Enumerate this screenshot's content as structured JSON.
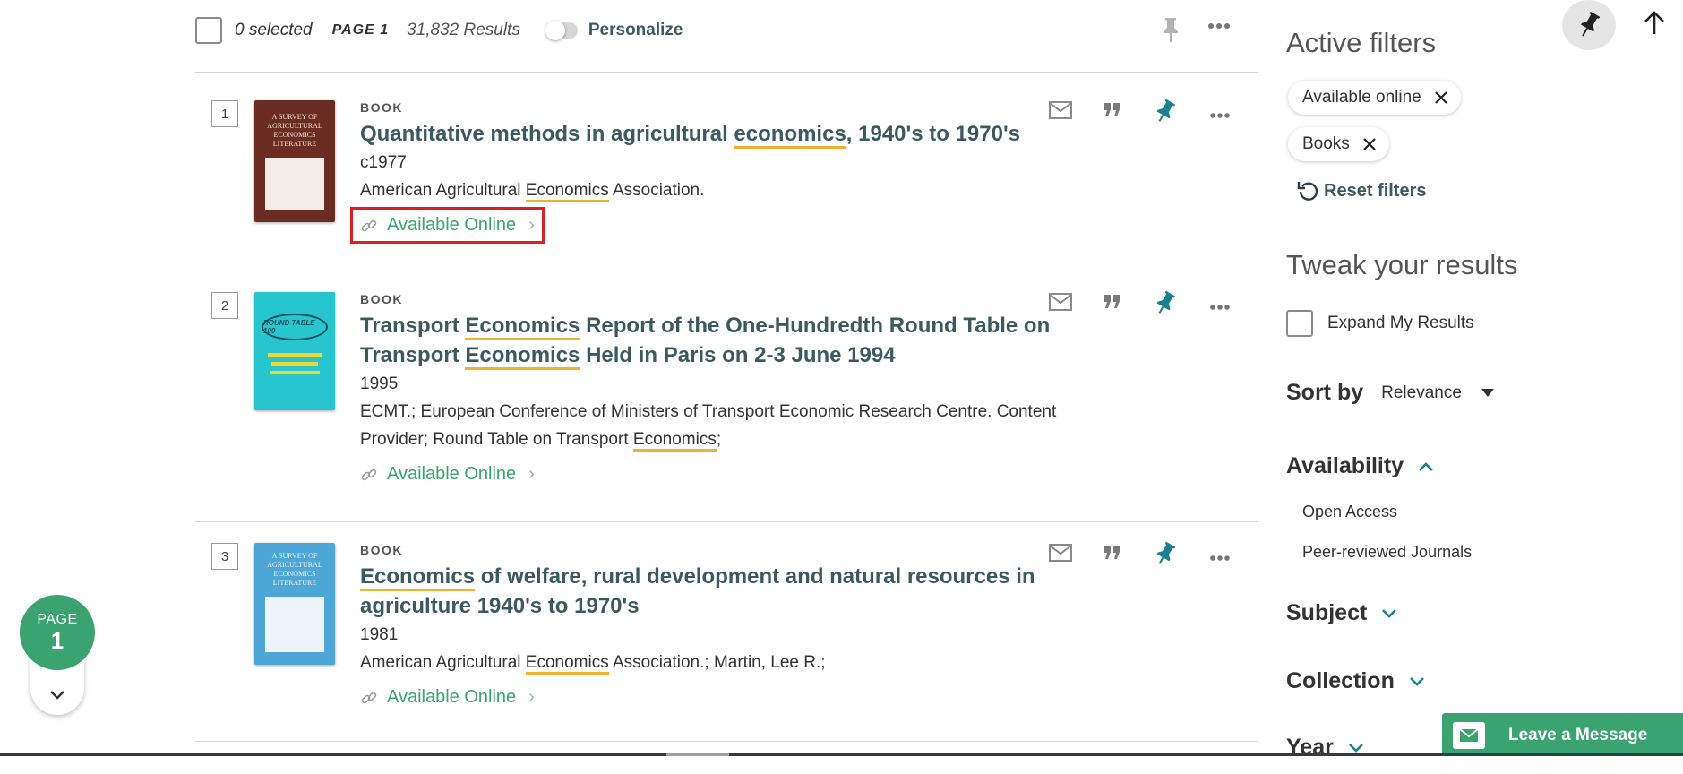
{
  "toolbar": {
    "selected": "0 selected",
    "page": "PAGE 1",
    "results": "31,832 Results",
    "personalize": "Personalize"
  },
  "results": [
    {
      "number": "1",
      "type": "BOOK",
      "title_parts": [
        "Quantitative methods in agricultural ",
        "economics",
        ", 1940's to 1970's"
      ],
      "date": "c1977",
      "creator_parts": [
        "American Agricultural ",
        "Economics",
        " Association."
      ],
      "availability": "Available Online",
      "cover_text": "A SURVEY OF AGRICULTURAL ECONOMICS LITERATURE"
    },
    {
      "number": "2",
      "type": "BOOK",
      "title_line1_parts": [
        "Transport ",
        "Economics",
        " Report of the One-Hundredth Round Table on"
      ],
      "title_line2_parts": [
        "Transport ",
        "Economics",
        " Held in Paris on 2-3 June 1994"
      ],
      "date": "1995",
      "creator_line1": "ECMT.; European Conference of Ministers of Transport Economic Research Centre. Content",
      "creator_line2_parts": [
        "Provider; Round Table on Transport ",
        "Economics",
        ";"
      ],
      "availability": "Available Online",
      "cover_text": "ROUND TABLE 100"
    },
    {
      "number": "3",
      "type": "BOOK",
      "title_line1_parts": [
        "Economics",
        " of welfare, rural development and natural resources in"
      ],
      "title_line2": "agriculture 1940's to 1970's",
      "date": "1981",
      "creator_parts": [
        "American Agricultural ",
        "Economics",
        " Association.; Martin, Lee R.;"
      ],
      "availability": "Available Online",
      "cover_text": "A SURVEY OF AGRICULTURAL ECONOMICS LITERATURE"
    }
  ],
  "page_indicator": {
    "label": "PAGE",
    "number": "1"
  },
  "sidebar": {
    "active_filters_title": "Active filters",
    "filters": [
      "Available online",
      "Books"
    ],
    "reset": "Reset filters",
    "tweak_title": "Tweak your results",
    "expand": "Expand My Results",
    "sort_label": "Sort by",
    "sort_value": "Relevance",
    "availability": "Availability",
    "availability_options": [
      "Open Access",
      "Peer-reviewed Journals"
    ],
    "subject": "Subject",
    "collection": "Collection",
    "year": "Year"
  },
  "chat": {
    "label": "Leave a Message"
  },
  "colors": {
    "accent": "#3aa36f",
    "title": "#3a5a60",
    "pin": "#1a7f8e",
    "highlight": "#f0b030",
    "box": "#d92027"
  }
}
